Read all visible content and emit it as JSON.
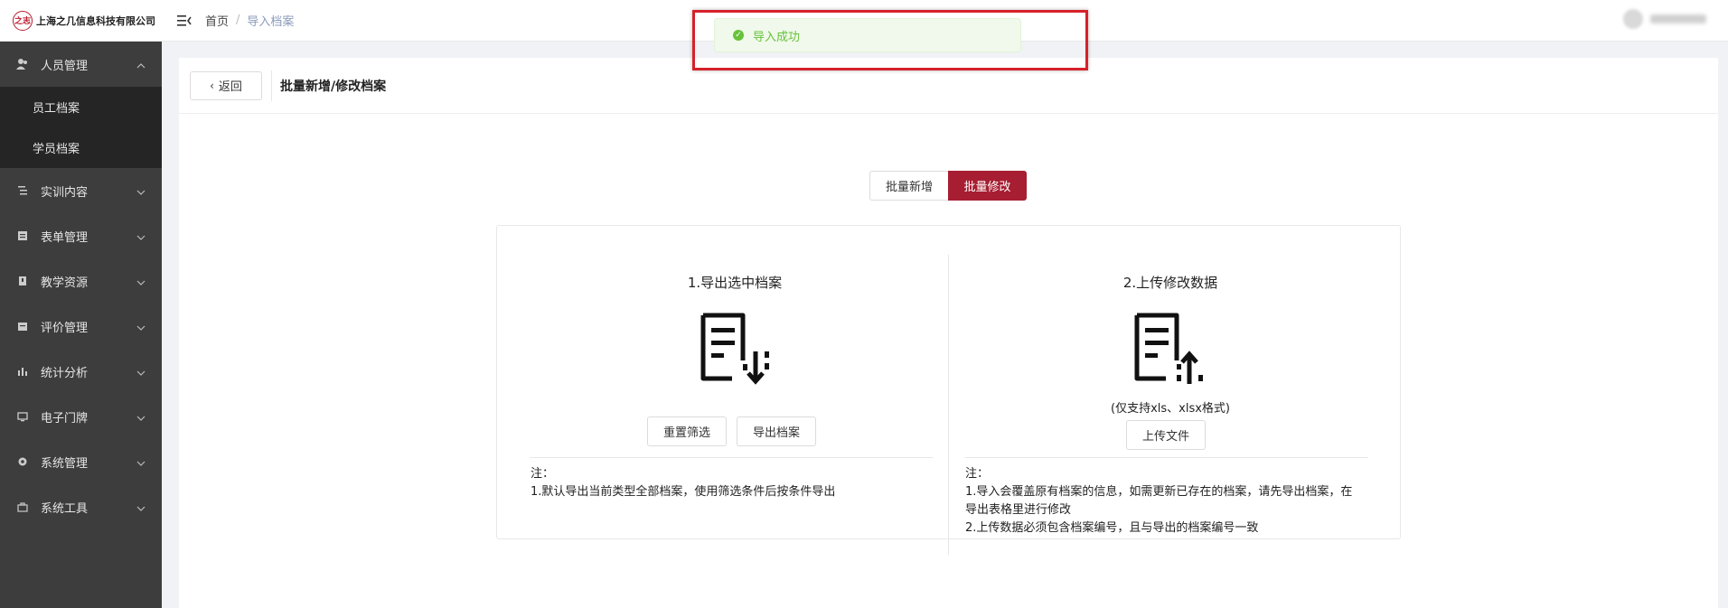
{
  "header": {
    "logo_mark": "之志",
    "company": "上海之几信息科技有限公司",
    "breadcrumb": {
      "home": "首页",
      "separator": "/",
      "current": "导入档案"
    }
  },
  "sidebar": {
    "items": [
      {
        "label": "人员管理",
        "icon": "user-icon",
        "expanded": true,
        "children": [
          "员工档案",
          "学员档案"
        ]
      },
      {
        "label": "实训内容",
        "icon": "list-icon"
      },
      {
        "label": "表单管理",
        "icon": "form-icon"
      },
      {
        "label": "教学资源",
        "icon": "book-icon"
      },
      {
        "label": "评价管理",
        "icon": "rating-icon"
      },
      {
        "label": "统计分析",
        "icon": "bar-chart-icon"
      },
      {
        "label": "电子门牌",
        "icon": "monitor-icon"
      },
      {
        "label": "系统管理",
        "icon": "gear-icon"
      },
      {
        "label": "系统工具",
        "icon": "toolbox-icon"
      }
    ]
  },
  "page": {
    "back_label": "返回",
    "title": "批量新增/修改档案",
    "tabs": [
      {
        "label": "批量新增",
        "active": false
      },
      {
        "label": "批量修改",
        "active": true
      }
    ],
    "export": {
      "title": "1.导出选中档案",
      "icon": "document-download-icon",
      "reset_label": "重置筛选",
      "export_label": "导出档案",
      "note_title": "注：",
      "note_lines": [
        "1.默认导出当前类型全部档案，使用筛选条件后按条件导出"
      ]
    },
    "upload": {
      "title": "2.上传修改数据",
      "icon": "document-upload-icon",
      "format_hint": "(仅支持xls、xlsx格式)",
      "upload_label": "上传文件",
      "note_title": "注：",
      "note_lines": [
        "1.导入会覆盖原有档案的信息，如需更新已存在的档案，请先导出档案，在",
        "导出表格里进行修改",
        "2.上传数据必须包含档案编号，且与导出的档案编号一致"
      ]
    }
  },
  "toast": {
    "message": "导入成功",
    "type": "success"
  },
  "colors": {
    "brand": "#a71d31",
    "sidebar_bg": "#3d3d3d",
    "submenu_bg": "#252525",
    "success": "#67c23a",
    "highlight": "#d6212a"
  }
}
